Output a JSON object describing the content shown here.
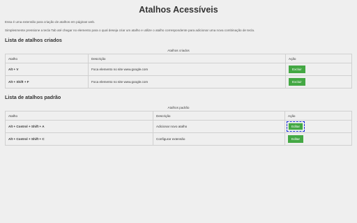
{
  "page": {
    "title": "Atalhos Acessíveis",
    "intro_line1": "Essa é uma extensão para criação de atalhos em páginas web.",
    "intro_line2": "Simplesmente pressione a tecla Tab até chegar no elemento para o qual deseja criar um atalho e utilize o atalho correspondente para adicionar uma nova combinação de tecla."
  },
  "created": {
    "heading": "Lista de atalhos criados",
    "caption": "Atalhos criados",
    "columns": [
      "Atalho",
      "Descrição",
      "Ação"
    ],
    "rows": [
      {
        "shortcut": "Alt + V",
        "description": "Foca elemento no site www.google.com",
        "action": "Excluir"
      },
      {
        "shortcut": "Alt + Shift + F",
        "description": "Foca elemento no site www.google.com",
        "action": "Excluir"
      }
    ]
  },
  "defaults": {
    "heading": "Lista de atalhos padrão",
    "caption": "Atalhos padrão",
    "columns": [
      "Atalho",
      "Descrição",
      "Ação"
    ],
    "rows": [
      {
        "shortcut": "Alt + Control + Shift + A",
        "description": "Adicionar novo atalho",
        "action": "Editar"
      },
      {
        "shortcut": "Alt + Control + Shift + C",
        "description": "Configurar extensão",
        "action": "Editar"
      }
    ]
  },
  "colors": {
    "button": "#44a844",
    "focus_ring": "#1a2ed8",
    "background": "#efefef"
  }
}
